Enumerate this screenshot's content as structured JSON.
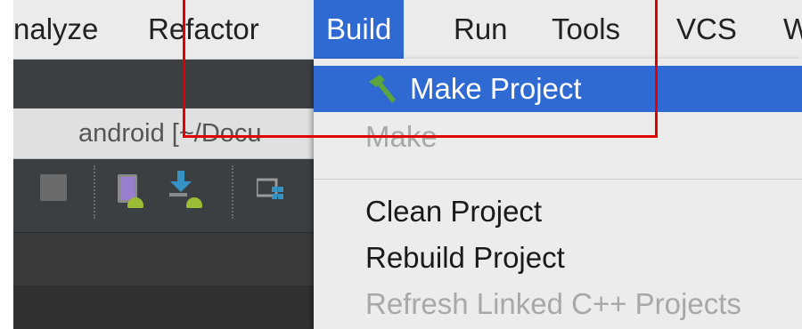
{
  "menubar": {
    "items": [
      "nalyze",
      "Refactor",
      "Build",
      "Run",
      "Tools",
      "VCS",
      "W"
    ],
    "active": "Build"
  },
  "window": {
    "title": "android [~/Docu"
  },
  "build_menu": {
    "items": [
      {
        "label": "Make Project",
        "state": "highlighted",
        "icon": "hammer-icon"
      },
      {
        "label": "Make",
        "state": "disabled"
      },
      {
        "label": "Clean Project",
        "state": "enabled"
      },
      {
        "label": "Rebuild Project",
        "state": "enabled"
      },
      {
        "label": "Refresh Linked C++ Projects",
        "state": "disabled"
      }
    ]
  },
  "colors": {
    "highlight": "#2f6ad3",
    "annotation": "#e00000",
    "ide_dark": "#3c3f41"
  },
  "icons": [
    "stop-icon",
    "device-android-icon",
    "download-android-icon",
    "project-structure-icon",
    "hammer-icon"
  ]
}
